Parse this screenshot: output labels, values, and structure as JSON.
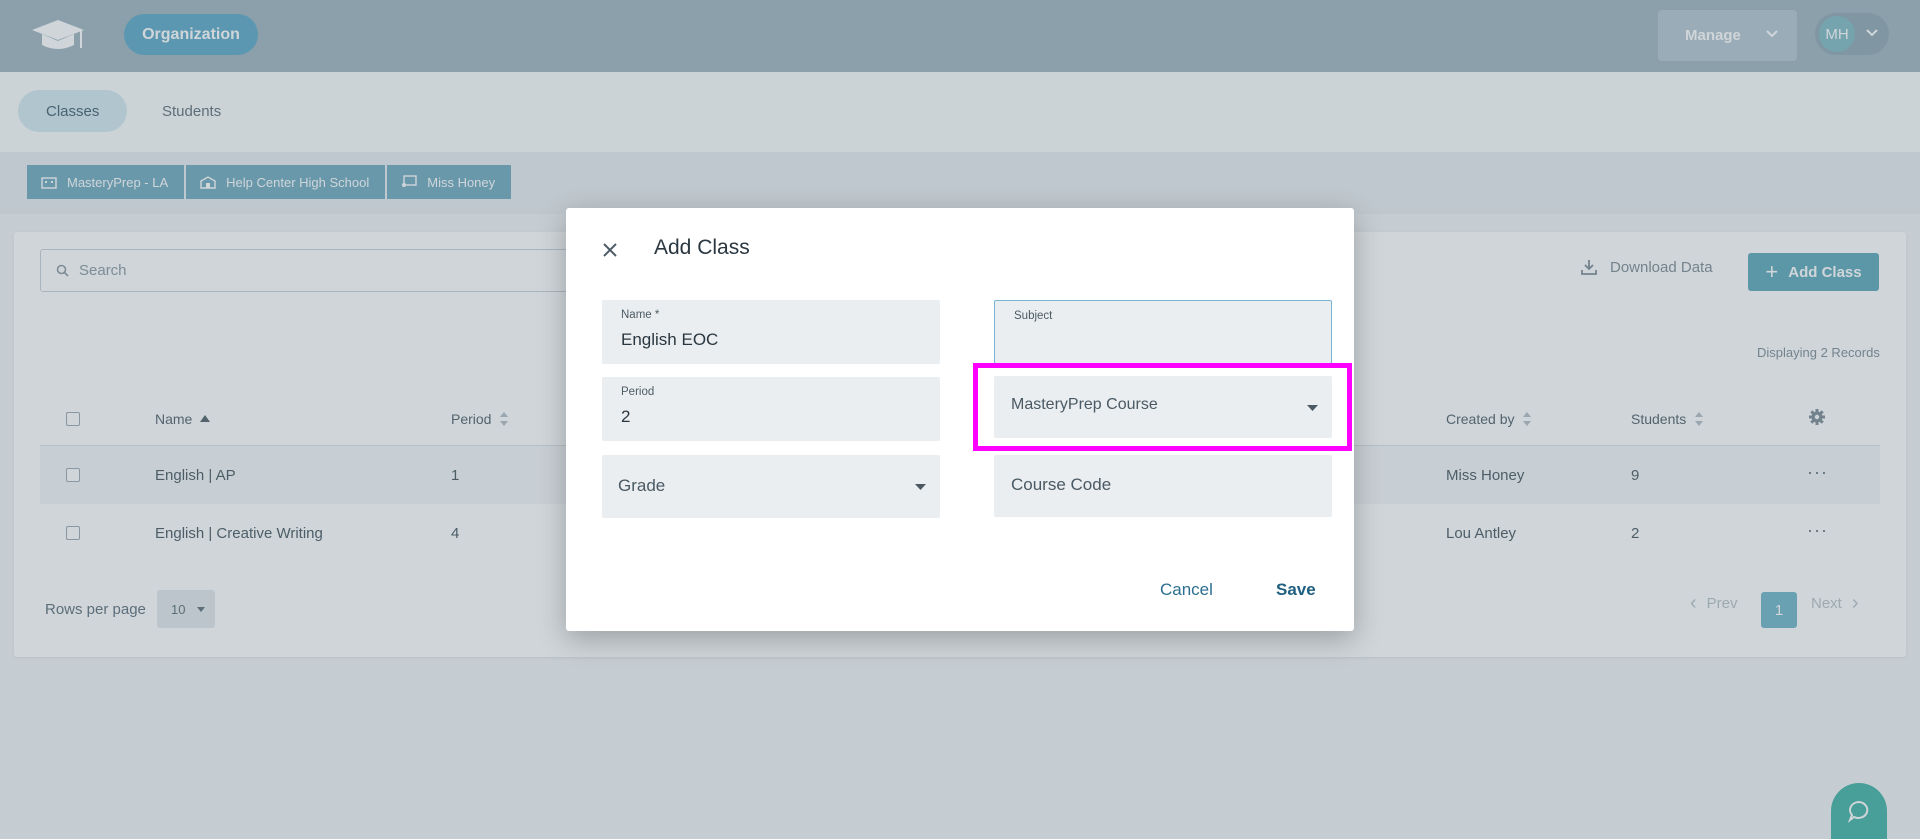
{
  "header": {
    "org_label": "Organization",
    "manage_label": "Manage",
    "avatar_initials": "MH"
  },
  "subnav": {
    "tabs": [
      "Classes",
      "Students"
    ]
  },
  "breadcrumb": [
    "MasteryPrep - LA",
    "Help Center High School",
    "Miss Honey"
  ],
  "toolbar": {
    "search_placeholder": "Search",
    "download_label": "Download Data",
    "add_class_label": "Add Class",
    "plus_glyph": "+",
    "records_text": "Displaying 2 Records"
  },
  "table": {
    "columns": [
      "Name",
      "Period",
      "Created by",
      "Students"
    ],
    "rows": [
      {
        "name": "English | AP",
        "period": "1",
        "created_by": "Miss Honey",
        "students": "9"
      },
      {
        "name": "English | Creative Writing",
        "period": "4",
        "created_by": "Lou Antley",
        "students": "2"
      }
    ],
    "row_menu_glyph": "···"
  },
  "pagination": {
    "rows_per_page_label": "Rows per page",
    "rows_per_page_value": "10",
    "prev_label": "Prev",
    "next_label": "Next",
    "current_page": "1",
    "prev_arrow": "‹",
    "next_arrow": "›"
  },
  "modal": {
    "title": "Add Class",
    "name_label": "Name *",
    "name_value": "English EOC",
    "subject_label": "Subject",
    "subject_value": "",
    "period_label": "Period",
    "period_value": "2",
    "course_placeholder": "MasteryPrep Course",
    "grade_placeholder": "Grade",
    "course_code_placeholder": "Course Code",
    "cancel_label": "Cancel",
    "save_label": "Save"
  },
  "colors": {
    "highlight": "#ff00ff",
    "accent": "#5aa6b8",
    "org_pill": "#5aa6c4",
    "chat_bubble": "#3eb0a2"
  }
}
